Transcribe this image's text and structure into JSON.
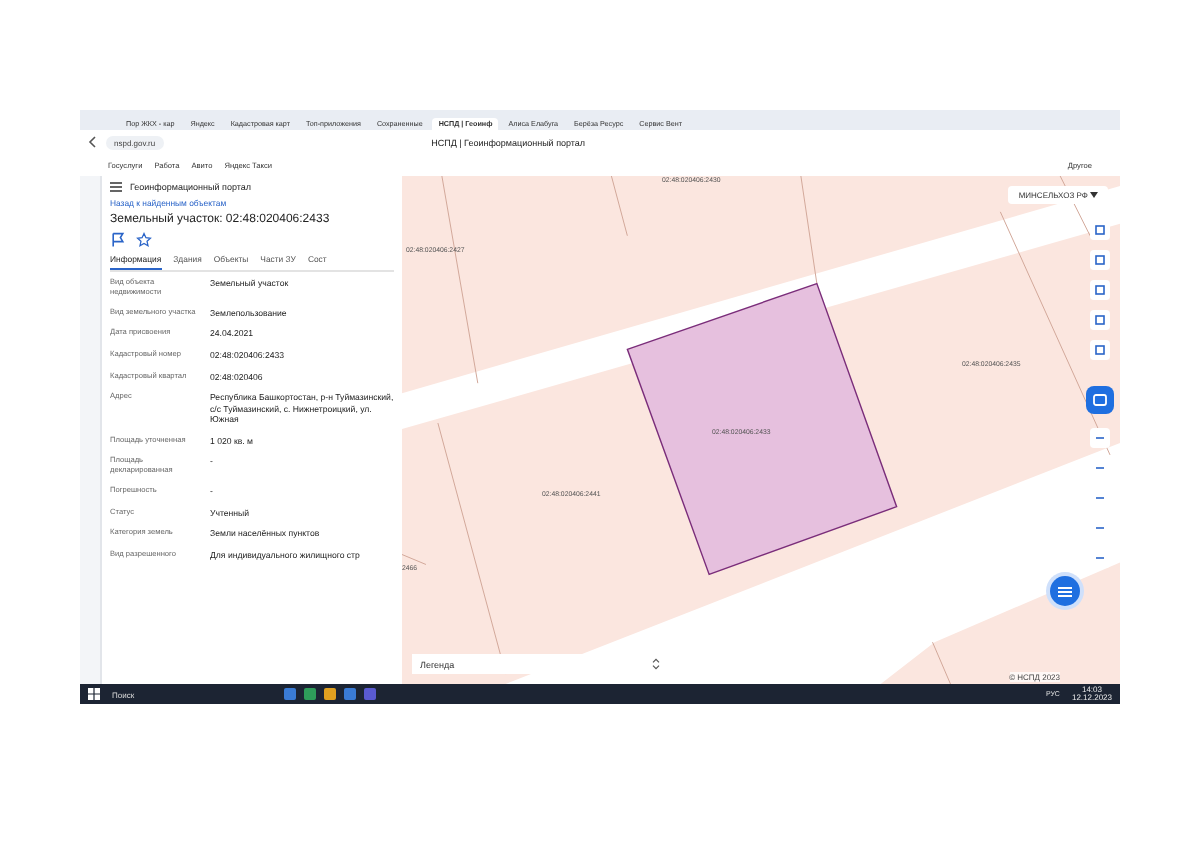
{
  "browser": {
    "tabs": [
      {
        "label": "Пор ЖКХ - кар",
        "selected": false
      },
      {
        "label": "Яндекс",
        "selected": false
      },
      {
        "label": "Кадастровая карт",
        "selected": false
      },
      {
        "label": "Топ-приложения",
        "selected": false
      },
      {
        "label": "Сохраненные",
        "selected": false
      },
      {
        "label": "НСПД | Геоинф",
        "selected": true
      },
      {
        "label": "Алиса Елабуга",
        "selected": false
      },
      {
        "label": "Берёза Ресурс",
        "selected": false
      },
      {
        "label": "Сервис Вент",
        "selected": false
      }
    ],
    "address": "nspd.gov.ru",
    "page_title": "НСПД | Геоинформационный портал",
    "bookmarks": [
      "Госуслуги",
      "Работа",
      "Авито",
      "Яндекс Такси"
    ],
    "other_bookmarks": "Другое"
  },
  "panel": {
    "portal": "Геоинформационный портал",
    "back_link": "Назад к найденным объектам",
    "heading": "Земельный участок: 02:48:020406:2433",
    "tabs": [
      {
        "label": "Информация",
        "selected": true
      },
      {
        "label": "Здания",
        "selected": false
      },
      {
        "label": "Объекты",
        "selected": false
      },
      {
        "label": "Части ЗУ",
        "selected": false
      },
      {
        "label": "Сост",
        "selected": false
      }
    ],
    "fields": [
      {
        "label": "Вид объекта недвижимости",
        "value": "Земельный участок"
      },
      {
        "label": "Вид земельного участка",
        "value": "Землепользование"
      },
      {
        "label": "Дата присвоения",
        "value": "24.04.2021"
      },
      {
        "label": "Кадастровый номер",
        "value": "02:48:020406:2433"
      },
      {
        "label": "Кадастровый квартал",
        "value": "02:48:020406"
      },
      {
        "label": "Адрес",
        "value": "Республика Башкортостан, р-н Туймазинский, с/с Туймазинский, с. Нижнетроицкий, ул. Южная"
      },
      {
        "label": "Площадь уточненная",
        "value": "1 020 кв. м"
      },
      {
        "label": "Площадь декларированная",
        "value": "-"
      },
      {
        "label": "Погрешность",
        "value": "-"
      },
      {
        "label": "Статус",
        "value": "Учтенный"
      },
      {
        "label": "Категория земель",
        "value": "Земли населённых пунктов"
      },
      {
        "label": "Вид разрешенного",
        "value": "Для индивидуального жилищного стр"
      }
    ]
  },
  "map": {
    "layer_select": "МИНСЕЛЬХОЗ РФ",
    "labels": [
      {
        "text": "02:48:020406:2430",
        "kind": "top"
      },
      {
        "text": "02:48:020406:2427",
        "kind": "left"
      },
      {
        "text": "02:48:020406:2435",
        "kind": "right"
      },
      {
        "text": "02:48:020406:2433",
        "kind": "selected"
      },
      {
        "text": "02:48:020406:2441",
        "kind": "lower"
      },
      {
        "text": "2466",
        "kind": "edge"
      }
    ],
    "legend": "Легенда",
    "scale": "© НСПД 2023"
  },
  "taskbar": {
    "search": "Поиск",
    "language": "РУС",
    "time": "14:03",
    "date": "12.12.2023"
  }
}
